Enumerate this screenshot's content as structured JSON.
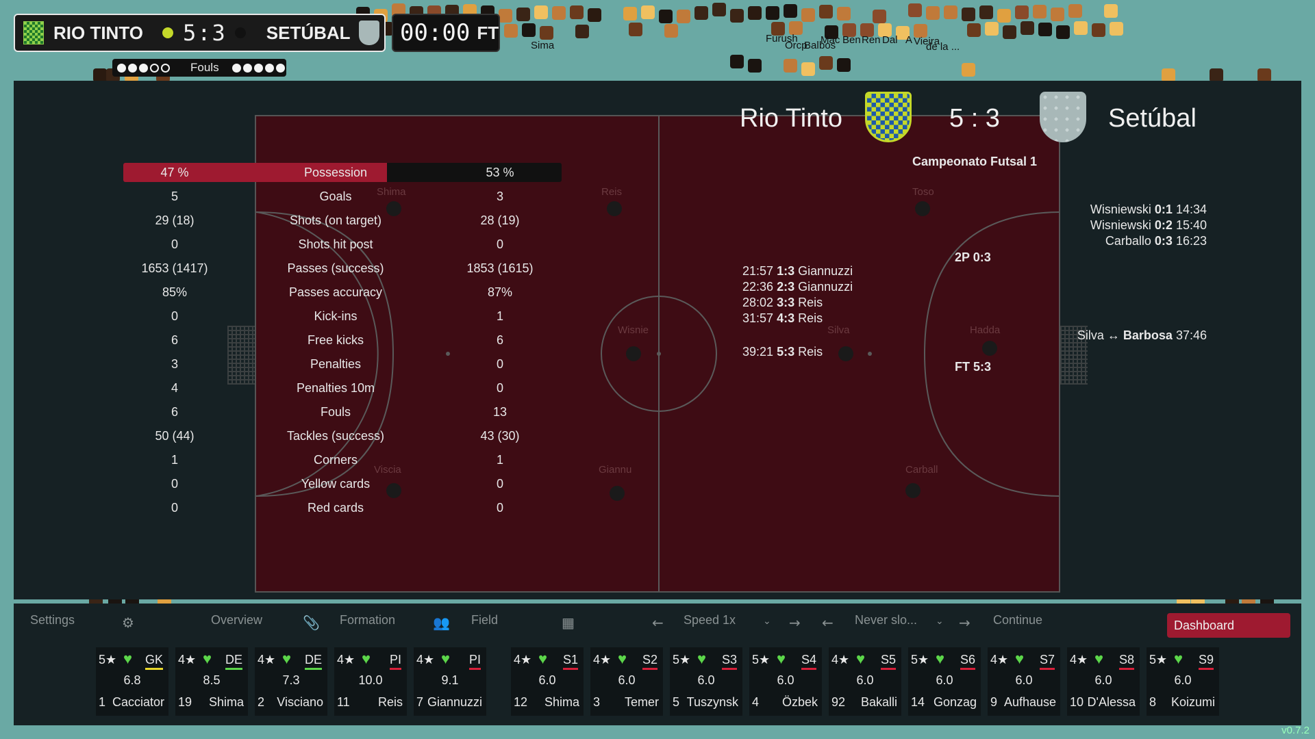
{
  "scorebar": {
    "home": "RIO TINTO",
    "away": "SETÚBAL",
    "score": "5:3",
    "home_dot_color": "#c4d82a",
    "away_dot_color": "#111111"
  },
  "clock": {
    "time": "00:00",
    "status": "FT"
  },
  "fouls": {
    "label": "Fouls",
    "home_filled": 3,
    "away_filled": 5,
    "max": 5
  },
  "crowd_names": [
    "Sima",
    "Furush",
    "Orcp",
    "Bal",
    "bos",
    "Mac",
    "Ben",
    "Ren",
    "Dal",
    "A",
    "Vieira",
    "de la ..."
  ],
  "header": {
    "home": "Rio Tinto",
    "away": "Setúbal",
    "score": "5 : 3",
    "competition": "Campeonato Futsal 1"
  },
  "stats": [
    {
      "home": "47 %",
      "label": "Possession",
      "away": "53 %"
    },
    {
      "home": "5",
      "label": "Goals",
      "away": "3"
    },
    {
      "home": "29 (18)",
      "label": "Shots (on target)",
      "away": "28 (19)"
    },
    {
      "home": "0",
      "label": "Shots hit post",
      "away": "0"
    },
    {
      "home": "1653 (1417)",
      "label": "Passes (success)",
      "away": "1853 (1615)"
    },
    {
      "home": "85%",
      "label": "Passes accuracy",
      "away": "87%"
    },
    {
      "home": "0",
      "label": "Kick-ins",
      "away": "1"
    },
    {
      "home": "6",
      "label": "Free kicks",
      "away": "6"
    },
    {
      "home": "3",
      "label": "Penalties",
      "away": "0"
    },
    {
      "home": "4",
      "label": "Penalties 10m",
      "away": "0"
    },
    {
      "home": "6",
      "label": "Fouls",
      "away": "13"
    },
    {
      "home": "50 (44)",
      "label": "Tackles (success)",
      "away": "43 (30)"
    },
    {
      "home": "1",
      "label": "Corners",
      "away": "1"
    },
    {
      "home": "0",
      "label": "Yellow cards",
      "away": "0"
    },
    {
      "home": "0",
      "label": "Red cards",
      "away": "0"
    }
  ],
  "possession_home_fraction": 0.47,
  "field_ghosts": [
    "Shima",
    "Reis",
    "Toso",
    "Wisnie",
    "Silva",
    "Hadda",
    "Viscia",
    "Giannu",
    "Carball"
  ],
  "home_goals": [
    {
      "time": "21:57",
      "score": "1:3",
      "player": "Giannuzzi"
    },
    {
      "time": "22:36",
      "score": "2:3",
      "player": "Giannuzzi"
    },
    {
      "time": "28:02",
      "score": "3:3",
      "player": "Reis"
    },
    {
      "time": "31:57",
      "score": "4:3",
      "player": "Reis"
    },
    {
      "time": "39:21",
      "score": "5:3",
      "player": "Reis"
    }
  ],
  "away_goals": [
    {
      "player": "Wisniewski",
      "score": "0:1",
      "time": "14:34"
    },
    {
      "player": "Wisniewski",
      "score": "0:2",
      "time": "15:40"
    },
    {
      "player": "Carballo",
      "score": "0:3",
      "time": "16:23"
    }
  ],
  "halftime": "2P 0:3",
  "fulltime": "FT 5:3",
  "substitution": {
    "out": "Silva",
    "arrow": "↔",
    "in": "Barbosa",
    "time": "37:46"
  },
  "nav": {
    "settings": "Settings",
    "overview": "Overview",
    "formation": "Formation",
    "field": "Field",
    "speed": "Speed 1x",
    "never": "Never slo...",
    "continue": "Continue",
    "dashboard": "Dashboard"
  },
  "icons": {
    "settings": "gear-icon",
    "overview": "paperclip-icon",
    "formation": "people-icon",
    "field": "pitch-icon"
  },
  "players": [
    {
      "stars": "5★",
      "pos": "GK",
      "pos_color": "#e8d82a",
      "rating": "6.8",
      "num": "1",
      "name": "Cacciator"
    },
    {
      "stars": "4★",
      "pos": "DE",
      "pos_color": "#5cd64a",
      "rating": "8.5",
      "num": "19",
      "name": "Shima"
    },
    {
      "stars": "4★",
      "pos": "DE",
      "pos_color": "#5cd64a",
      "rating": "7.3",
      "num": "2",
      "name": "Visciano"
    },
    {
      "stars": "4★",
      "pos": "PI",
      "pos_color": "#d8203a",
      "rating": "10.0",
      "num": "11",
      "name": "Reis"
    },
    {
      "stars": "4★",
      "pos": "PI",
      "pos_color": "#d8203a",
      "rating": "9.1",
      "num": "7",
      "name": "Giannuzzi"
    },
    {
      "stars": "4★",
      "pos": "S1",
      "pos_color": "#d8203a",
      "rating": "6.0",
      "num": "12",
      "name": "Shima"
    },
    {
      "stars": "4★",
      "pos": "S2",
      "pos_color": "#d8203a",
      "rating": "6.0",
      "num": "3",
      "name": "Temer"
    },
    {
      "stars": "5★",
      "pos": "S3",
      "pos_color": "#d8203a",
      "rating": "6.0",
      "num": "5",
      "name": "Tuszynsk"
    },
    {
      "stars": "5★",
      "pos": "S4",
      "pos_color": "#d8203a",
      "rating": "6.0",
      "num": "4",
      "name": "Özbek"
    },
    {
      "stars": "4★",
      "pos": "S5",
      "pos_color": "#d8203a",
      "rating": "6.0",
      "num": "92",
      "name": "Bakalli"
    },
    {
      "stars": "5★",
      "pos": "S6",
      "pos_color": "#d8203a",
      "rating": "6.0",
      "num": "14",
      "name": "Gonzag"
    },
    {
      "stars": "4★",
      "pos": "S7",
      "pos_color": "#d8203a",
      "rating": "6.0",
      "num": "9",
      "name": "Aufhause"
    },
    {
      "stars": "4★",
      "pos": "S8",
      "pos_color": "#d8203a",
      "rating": "6.0",
      "num": "10",
      "name": "D'Alessa"
    },
    {
      "stars": "5★",
      "pos": "S9",
      "pos_color": "#d8203a",
      "rating": "6.0",
      "num": "8",
      "name": "Koizumi"
    }
  ],
  "version": "v0.7.2"
}
